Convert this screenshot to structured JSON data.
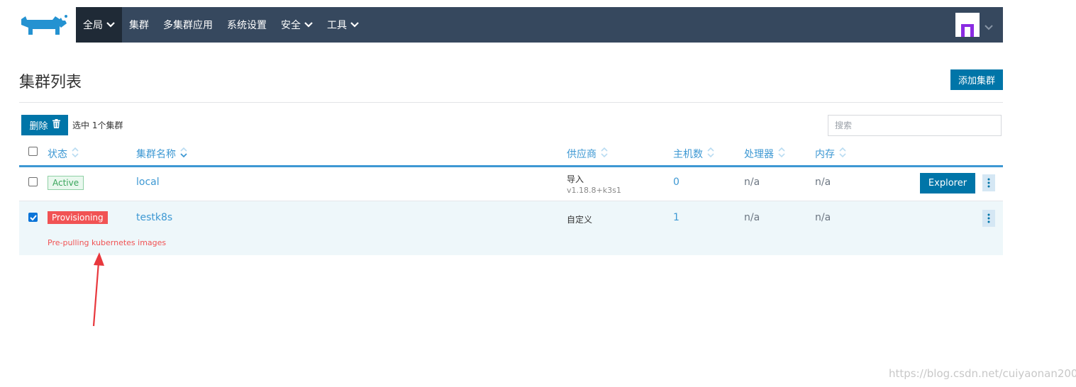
{
  "nav": {
    "items": [
      {
        "label": "全局",
        "has_dropdown": true,
        "active": true
      },
      {
        "label": "集群",
        "has_dropdown": false
      },
      {
        "label": "多集群应用",
        "has_dropdown": false
      },
      {
        "label": "系统设置",
        "has_dropdown": false
      },
      {
        "label": "安全",
        "has_dropdown": true
      },
      {
        "label": "工具",
        "has_dropdown": true
      }
    ],
    "logo_icon": "rancher-cow-icon",
    "avatar_icon": "user-avatar-icon",
    "colors": {
      "bar": "#36485e",
      "active": "#1f2a36"
    }
  },
  "page": {
    "title": "集群列表",
    "add_button": "添加集群"
  },
  "toolbar": {
    "delete_label": "删除",
    "delete_icon": "trash-icon",
    "selected_count": "选中 1个集群",
    "search_placeholder": "搜索"
  },
  "table": {
    "headers": [
      "状态",
      "集群名称",
      "供应商",
      "主机数",
      "处理器",
      "内存"
    ],
    "rows": [
      {
        "checked": false,
        "state": "Active",
        "name": "local",
        "provider": "导入",
        "provider_version": "v1.18.8+k3s1",
        "nodes": "0",
        "cpu": "n/a",
        "memory": "n/a",
        "action_button": "Explorer",
        "message": ""
      },
      {
        "checked": true,
        "state": "Provisioning",
        "name": "testk8s",
        "provider": "自定义",
        "provider_version": "",
        "nodes": "1",
        "cpu": "n/a",
        "memory": "n/a",
        "action_button": "",
        "message": "Pre-pulling kubernetes images"
      }
    ]
  },
  "colors": {
    "primary": "#0075a8",
    "link": "#3d98d3",
    "active_badge": "#39a55b",
    "provisioning_badge": "#f15354",
    "annotation_arrow": "#e8383d"
  },
  "watermark": "https://blog.csdn.net/cuiyaonan2000"
}
